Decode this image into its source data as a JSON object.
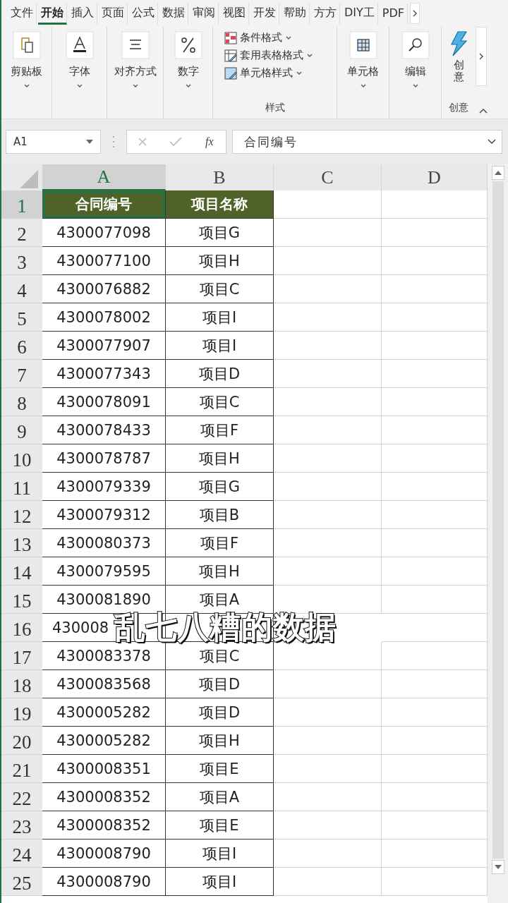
{
  "ribbon": {
    "tabs": [
      {
        "label": "文件",
        "selected": false
      },
      {
        "label": "开始",
        "selected": true
      },
      {
        "label": "插入",
        "selected": false
      },
      {
        "label": "页面",
        "selected": false
      },
      {
        "label": "公式",
        "selected": false
      },
      {
        "label": "数据",
        "selected": false
      },
      {
        "label": "审阅",
        "selected": false
      },
      {
        "label": "视图",
        "selected": false
      },
      {
        "label": "开发",
        "selected": false
      },
      {
        "label": "帮助",
        "selected": false
      },
      {
        "label": "方方",
        "selected": false
      },
      {
        "label": "DIY工",
        "selected": false
      },
      {
        "label": "PDF",
        "selected": false
      }
    ],
    "groups": [
      {
        "kind": "big",
        "label": "剪贴板"
      },
      {
        "kind": "big",
        "label": "字体"
      },
      {
        "kind": "big",
        "label": "对齐方式"
      },
      {
        "kind": "big",
        "label": "数字"
      },
      {
        "kind": "list",
        "items": [
          "条件格式",
          "套用表格格式",
          "单元格样式"
        ],
        "group_label": "样式"
      },
      {
        "kind": "big",
        "label": "单元格"
      },
      {
        "kind": "big",
        "label": "编辑"
      },
      {
        "kind": "cut",
        "label": "创意",
        "group_label": "创意"
      }
    ]
  },
  "formula_bar": {
    "name_box": "A1",
    "function_label": "fx",
    "formula": "合同编号"
  },
  "sheet": {
    "columns": [
      {
        "label": "A",
        "selected": true
      },
      {
        "label": "B",
        "selected": false
      },
      {
        "label": "C",
        "selected": false
      },
      {
        "label": "D",
        "selected": false
      }
    ],
    "rows": [
      {
        "number": "1",
        "selected": true,
        "kind": "header",
        "cells": [
          {
            "text": "合同编号",
            "selected": true
          },
          {
            "text": "项目名称",
            "selected": false
          }
        ]
      },
      {
        "number": "2",
        "selected": false,
        "kind": "data",
        "cells": [
          {
            "text": "4300077098",
            "selected": false
          },
          {
            "text": "项目G",
            "selected": false
          }
        ]
      },
      {
        "number": "3",
        "selected": false,
        "kind": "data",
        "cells": [
          {
            "text": "4300077100",
            "selected": false
          },
          {
            "text": "项目H",
            "selected": false
          }
        ]
      },
      {
        "number": "4",
        "selected": false,
        "kind": "data",
        "cells": [
          {
            "text": "4300076882",
            "selected": false
          },
          {
            "text": "项目C",
            "selected": false
          }
        ]
      },
      {
        "number": "5",
        "selected": false,
        "kind": "data",
        "cells": [
          {
            "text": "4300078002",
            "selected": false
          },
          {
            "text": "项目I",
            "selected": false
          }
        ]
      },
      {
        "number": "6",
        "selected": false,
        "kind": "data",
        "cells": [
          {
            "text": "4300077907",
            "selected": false
          },
          {
            "text": "项目I",
            "selected": false
          }
        ]
      },
      {
        "number": "7",
        "selected": false,
        "kind": "data",
        "cells": [
          {
            "text": "4300077343",
            "selected": false
          },
          {
            "text": "项目D",
            "selected": false
          }
        ]
      },
      {
        "number": "8",
        "selected": false,
        "kind": "data",
        "cells": [
          {
            "text": "4300078091",
            "selected": false
          },
          {
            "text": "项目C",
            "selected": false
          }
        ]
      },
      {
        "number": "9",
        "selected": false,
        "kind": "data",
        "cells": [
          {
            "text": "4300078433",
            "selected": false
          },
          {
            "text": "项目F",
            "selected": false
          }
        ]
      },
      {
        "number": "10",
        "selected": false,
        "kind": "data",
        "cells": [
          {
            "text": "4300078787",
            "selected": false
          },
          {
            "text": "项目H",
            "selected": false
          }
        ]
      },
      {
        "number": "11",
        "selected": false,
        "kind": "data",
        "cells": [
          {
            "text": "4300079339",
            "selected": false
          },
          {
            "text": "项目G",
            "selected": false
          }
        ]
      },
      {
        "number": "12",
        "selected": false,
        "kind": "data",
        "cells": [
          {
            "text": "4300079312",
            "selected": false
          },
          {
            "text": "项目B",
            "selected": false
          }
        ]
      },
      {
        "number": "13",
        "selected": false,
        "kind": "data",
        "cells": [
          {
            "text": "4300080373",
            "selected": false
          },
          {
            "text": "项目F",
            "selected": false
          }
        ]
      },
      {
        "number": "14",
        "selected": false,
        "kind": "data",
        "cells": [
          {
            "text": "4300079595",
            "selected": false
          },
          {
            "text": "项目H",
            "selected": false
          }
        ]
      },
      {
        "number": "15",
        "selected": false,
        "kind": "data",
        "cells": [
          {
            "text": "4300081890",
            "selected": false
          },
          {
            "text": "项目A",
            "selected": false
          }
        ]
      },
      {
        "number": "16",
        "selected": false,
        "kind": "data",
        "cells": [
          {
            "text": "430008",
            "selected": false
          }
        ]
      },
      {
        "number": "17",
        "selected": false,
        "kind": "data",
        "cells": [
          {
            "text": "4300083378",
            "selected": false
          },
          {
            "text": "项目C",
            "selected": false
          }
        ]
      },
      {
        "number": "18",
        "selected": false,
        "kind": "data",
        "cells": [
          {
            "text": "4300083568",
            "selected": false
          },
          {
            "text": "项目D",
            "selected": false
          }
        ]
      },
      {
        "number": "19",
        "selected": false,
        "kind": "data",
        "cells": [
          {
            "text": "4300005282",
            "selected": false
          },
          {
            "text": "项目D",
            "selected": false
          }
        ]
      },
      {
        "number": "20",
        "selected": false,
        "kind": "data",
        "cells": [
          {
            "text": "4300005282",
            "selected": false
          },
          {
            "text": "项目H",
            "selected": false
          }
        ]
      },
      {
        "number": "21",
        "selected": false,
        "kind": "data",
        "cells": [
          {
            "text": "4300008351",
            "selected": false
          },
          {
            "text": "项目E",
            "selected": false
          }
        ]
      },
      {
        "number": "22",
        "selected": false,
        "kind": "data",
        "cells": [
          {
            "text": "4300008352",
            "selected": false
          },
          {
            "text": "项目A",
            "selected": false
          }
        ]
      },
      {
        "number": "23",
        "selected": false,
        "kind": "data",
        "cells": [
          {
            "text": "4300008352",
            "selected": false
          },
          {
            "text": "项目E",
            "selected": false
          }
        ]
      },
      {
        "number": "24",
        "selected": false,
        "kind": "data",
        "cells": [
          {
            "text": "4300008790",
            "selected": false
          },
          {
            "text": "项目I",
            "selected": false
          }
        ]
      },
      {
        "number": "25",
        "selected": false,
        "kind": "data",
        "cells": [
          {
            "text": "4300008790",
            "selected": false
          },
          {
            "text": "项目I",
            "selected": false
          }
        ]
      }
    ]
  },
  "caption": "乱七八糟的数据"
}
